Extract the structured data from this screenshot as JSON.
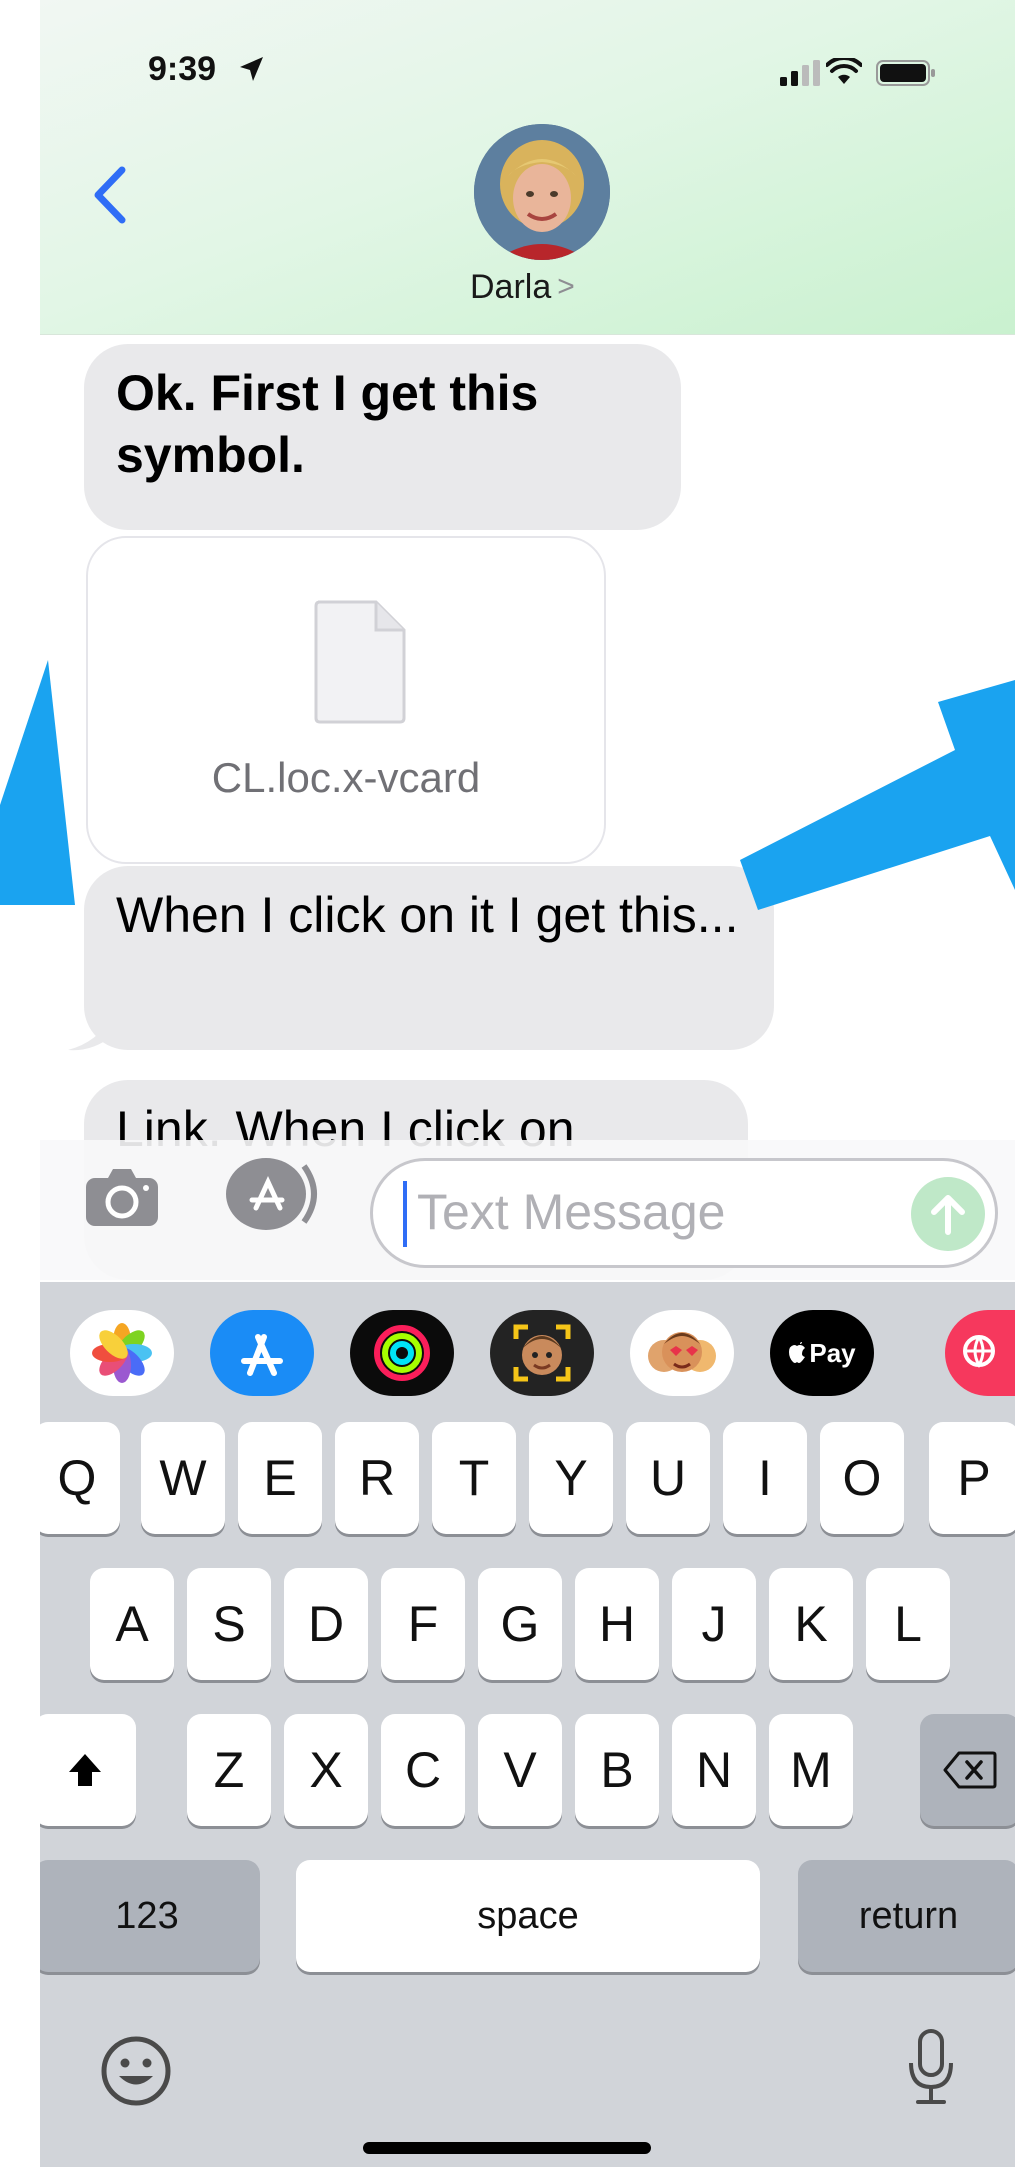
{
  "status_bar": {
    "time": "9:39"
  },
  "header": {
    "contact_name": "Darla",
    "chevron": ">"
  },
  "messages": [
    {
      "id": "m1",
      "text": "Ok. First I get this symbol."
    },
    {
      "id": "m2",
      "type": "attachment",
      "filename": "CL.loc.x-vcard"
    },
    {
      "id": "m3",
      "text": "When I click on it I get this..."
    },
    {
      "id": "m4",
      "text": "Link. When I click on"
    }
  ],
  "input": {
    "placeholder": "Text Message"
  },
  "keyboard": {
    "row1": [
      "Q",
      "W",
      "E",
      "R",
      "T",
      "Y",
      "U",
      "I",
      "O",
      "P"
    ],
    "row2": [
      "A",
      "S",
      "D",
      "F",
      "G",
      "H",
      "J",
      "K",
      "L"
    ],
    "row3": [
      "Z",
      "X",
      "C",
      "V",
      "B",
      "N",
      "M"
    ],
    "numbers_label": "123",
    "space_label": "space",
    "return_label": "return",
    "apple_pay_label": "Pay"
  },
  "icons": {
    "back": "chevron-left-icon",
    "camera": "camera-icon",
    "app_store": "app-store-icon",
    "send": "arrow-up-icon",
    "shift": "shift-icon",
    "delete": "delete-icon",
    "emoji": "emoji-icon",
    "mic": "microphone-icon"
  },
  "colors": {
    "accent": "#2f6df6",
    "received_bubble": "#e9e9eb",
    "annotation_arrow": "#1aa3f0",
    "keyboard_bg": "#d1d4d9"
  }
}
